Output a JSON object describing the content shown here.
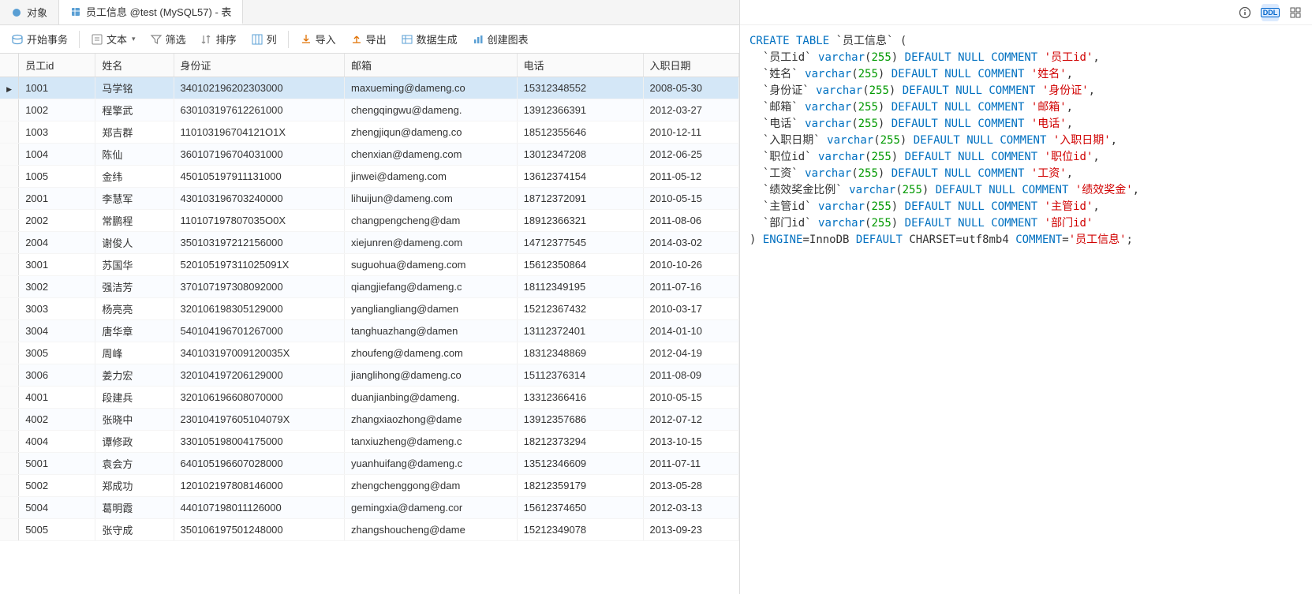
{
  "tabs": [
    {
      "label": "对象",
      "icon": "ball"
    },
    {
      "label": "员工信息 @test (MySQL57) - 表",
      "icon": "table",
      "active": true
    }
  ],
  "toolbar": {
    "start_tx": "开始事务",
    "text": "文本",
    "filter": "筛选",
    "sort": "排序",
    "columns": "列",
    "import": "导入",
    "export": "导出",
    "datagen": "数据生成",
    "chart": "创建图表"
  },
  "columns": [
    "员工id",
    "姓名",
    "身份证",
    "邮箱",
    "电话",
    "入职日期"
  ],
  "selected_row_index": 0,
  "rows": [
    [
      "1001",
      "马学铭",
      "340102196202303000",
      "maxueming@dameng.co",
      "15312348552",
      "2008-05-30"
    ],
    [
      "1002",
      "程擎武",
      "630103197612261000",
      "chengqingwu@dameng.",
      "13912366391",
      "2012-03-27"
    ],
    [
      "1003",
      "郑吉群",
      "110103196704121O1X",
      "zhengjiqun@dameng.co",
      "18512355646",
      "2010-12-11"
    ],
    [
      "1004",
      "陈仙",
      "360107196704031000",
      "chenxian@dameng.com",
      "13012347208",
      "2012-06-25"
    ],
    [
      "1005",
      "金纬",
      "450105197911131000",
      "jinwei@dameng.com",
      "13612374154",
      "2011-05-12"
    ],
    [
      "2001",
      "李慧军",
      "430103196703240000",
      "lihuijun@dameng.com",
      "18712372091",
      "2010-05-15"
    ],
    [
      "2002",
      "常鹏程",
      "110107197807035O0X",
      "changpengcheng@dam",
      "18912366321",
      "2011-08-06"
    ],
    [
      "2004",
      "谢俊人",
      "350103197212156000",
      "xiejunren@dameng.com",
      "14712377545",
      "2014-03-02"
    ],
    [
      "3001",
      "苏国华",
      "520105197311025091X",
      "suguohua@dameng.com",
      "15612350864",
      "2010-10-26"
    ],
    [
      "3002",
      "强洁芳",
      "370107197308092000",
      "qiangjiefang@dameng.c",
      "18112349195",
      "2011-07-16"
    ],
    [
      "3003",
      "杨亮亮",
      "320106198305129000",
      "yangliangliang@damen",
      "15212367432",
      "2010-03-17"
    ],
    [
      "3004",
      "唐华章",
      "540104196701267000",
      "tanghuazhang@damen",
      "13112372401",
      "2014-01-10"
    ],
    [
      "3005",
      "周峰",
      "340103197009120035X",
      "zhoufeng@dameng.com",
      "18312348869",
      "2012-04-19"
    ],
    [
      "3006",
      "姜力宏",
      "320104197206129000",
      "jianglihong@dameng.co",
      "15112376314",
      "2011-08-09"
    ],
    [
      "4001",
      "段建兵",
      "320106196608070000",
      "duanjianbing@dameng.",
      "13312366416",
      "2010-05-15"
    ],
    [
      "4002",
      "张晓中",
      "230104197605104079X",
      "zhangxiaozhong@dame",
      "13912357686",
      "2012-07-12"
    ],
    [
      "4004",
      "谭修政",
      "330105198004175000",
      "tanxiuzheng@dameng.c",
      "18212373294",
      "2013-10-15"
    ],
    [
      "5001",
      "袁会方",
      "640105196607028000",
      "yuanhuifang@dameng.c",
      "13512346609",
      "2011-07-11"
    ],
    [
      "5002",
      "郑成功",
      "120102197808146000",
      "zhengchenggong@dam",
      "18212359179",
      "2013-05-28"
    ],
    [
      "5004",
      "葛明霞",
      "440107198011126000",
      "gemingxia@dameng.cor",
      "15612374650",
      "2012-03-13"
    ],
    [
      "5005",
      "张守成",
      "350106197501248000",
      "zhangshoucheng@dame",
      "15212349078",
      "2013-09-23"
    ]
  ],
  "right_icons": {
    "info": "ⓘ",
    "ddl": "DDL",
    "grid": "⊞"
  },
  "ddl": {
    "create": "CREATE TABLE",
    "table_name": "员工信息",
    "varchar": "varchar",
    "size": "255",
    "default_null_comment": "DEFAULT NULL COMMENT",
    "engine_line_prefix": "ENGINE",
    "engine_val": "InnoDB",
    "default_kw": "DEFAULT",
    "charset": "CHARSET=utf8mb4",
    "comment_kw": "COMMENT",
    "table_comment": "员工信息",
    "cols": [
      {
        "name": "员工id",
        "comment": "员工id"
      },
      {
        "name": "姓名",
        "comment": "姓名"
      },
      {
        "name": "身份证",
        "comment": "身份证"
      },
      {
        "name": "邮箱",
        "comment": "邮箱"
      },
      {
        "name": "电话",
        "comment": "电话"
      },
      {
        "name": "入职日期",
        "comment": "入职日期"
      },
      {
        "name": "职位id",
        "comment": "职位id"
      },
      {
        "name": "工资",
        "comment": "工资"
      },
      {
        "name": "绩效奖金比例",
        "comment": "绩效奖金"
      },
      {
        "name": "主管id",
        "comment": "主管id"
      },
      {
        "name": "部门id",
        "comment": "部门id"
      }
    ]
  }
}
